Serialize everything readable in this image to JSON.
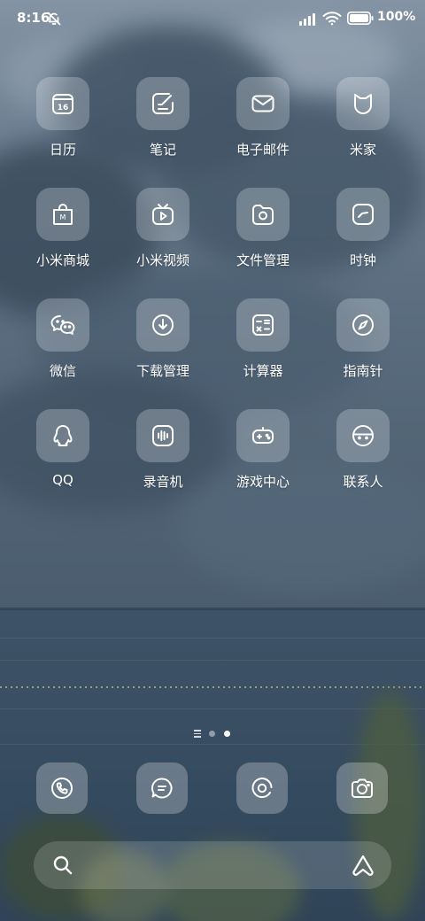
{
  "status_bar": {
    "time": "8:16",
    "battery_text": "100%",
    "icons": [
      "bell-off-icon",
      "signal-icon",
      "wifi-icon",
      "battery-icon"
    ]
  },
  "apps": [
    {
      "label": "日历",
      "icon": "calendar-icon",
      "date": "16"
    },
    {
      "label": "笔记",
      "icon": "notes-icon"
    },
    {
      "label": "电子邮件",
      "icon": "mail-icon"
    },
    {
      "label": "米家",
      "icon": "mijia-icon"
    },
    {
      "label": "小米商城",
      "icon": "mi-store-icon",
      "badge": "M"
    },
    {
      "label": "小米视频",
      "icon": "video-icon"
    },
    {
      "label": "文件管理",
      "icon": "file-manager-icon"
    },
    {
      "label": "时钟",
      "icon": "clock-icon"
    },
    {
      "label": "微信",
      "icon": "wechat-icon"
    },
    {
      "label": "下载管理",
      "icon": "download-icon"
    },
    {
      "label": "计算器",
      "icon": "calculator-icon"
    },
    {
      "label": "指南针",
      "icon": "compass-icon"
    },
    {
      "label": "QQ",
      "icon": "qq-icon"
    },
    {
      "label": "录音机",
      "icon": "recorder-icon"
    },
    {
      "label": "游戏中心",
      "icon": "game-center-icon"
    },
    {
      "label": "联系人",
      "icon": "contacts-icon"
    }
  ],
  "page_indicator": {
    "pages": 2,
    "current": 2
  },
  "dock": [
    {
      "icon": "phone-icon"
    },
    {
      "icon": "messages-icon"
    },
    {
      "icon": "browser-icon"
    },
    {
      "icon": "camera-icon"
    }
  ],
  "search_bar": {
    "icons": [
      "search-icon",
      "assistant-icon"
    ]
  },
  "colors": {
    "icon_background": "rgba(255,255,255,0.24)",
    "text": "#ffffff"
  }
}
